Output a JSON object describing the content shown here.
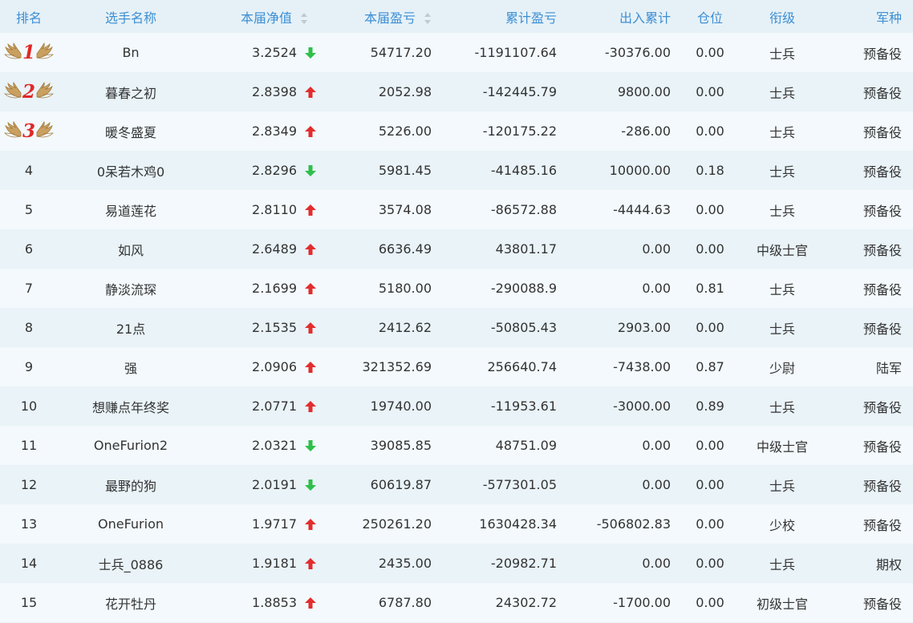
{
  "table": {
    "headers": {
      "rank": "排名",
      "player_name": "选手名称",
      "net_value": "本届净值",
      "profit": "本届盈亏",
      "cumulative_profit": "累计盈亏",
      "in_out_total": "出入累计",
      "position": "仓位",
      "rank_title": "衔级",
      "branch": "军种"
    },
    "sortable_columns": [
      "net_value",
      "profit"
    ],
    "rows": [
      {
        "rank": "1",
        "name": "Bn",
        "net_value": "3.2524",
        "trend": "down",
        "profit": "54717.20",
        "cumulative": "-1191107.64",
        "in_out": "-30376.00",
        "position": "0.00",
        "title": "士兵",
        "branch": "预备役"
      },
      {
        "rank": "2",
        "name": "暮春之初",
        "net_value": "2.8398",
        "trend": "up",
        "profit": "2052.98",
        "cumulative": "-142445.79",
        "in_out": "9800.00",
        "position": "0.00",
        "title": "士兵",
        "branch": "预备役"
      },
      {
        "rank": "3",
        "name": "暖冬盛夏",
        "net_value": "2.8349",
        "trend": "up",
        "profit": "5226.00",
        "cumulative": "-120175.22",
        "in_out": "-286.00",
        "position": "0.00",
        "title": "士兵",
        "branch": "预备役"
      },
      {
        "rank": "4",
        "name": "0呆若木鸡0",
        "net_value": "2.8296",
        "trend": "down",
        "profit": "5981.45",
        "cumulative": "-41485.16",
        "in_out": "10000.00",
        "position": "0.18",
        "title": "士兵",
        "branch": "预备役"
      },
      {
        "rank": "5",
        "name": "易道莲花",
        "net_value": "2.8110",
        "trend": "up",
        "profit": "3574.08",
        "cumulative": "-86572.88",
        "in_out": "-4444.63",
        "position": "0.00",
        "title": "士兵",
        "branch": "预备役"
      },
      {
        "rank": "6",
        "name": "如风",
        "net_value": "2.6489",
        "trend": "up",
        "profit": "6636.49",
        "cumulative": "43801.17",
        "in_out": "0.00",
        "position": "0.00",
        "title": "中级士官",
        "branch": "预备役"
      },
      {
        "rank": "7",
        "name": "静淡流琛",
        "net_value": "2.1699",
        "trend": "up",
        "profit": "5180.00",
        "cumulative": "-290088.9",
        "in_out": "0.00",
        "position": "0.81",
        "title": "士兵",
        "branch": "预备役"
      },
      {
        "rank": "8",
        "name": "21点",
        "net_value": "2.1535",
        "trend": "up",
        "profit": "2412.62",
        "cumulative": "-50805.43",
        "in_out": "2903.00",
        "position": "0.00",
        "title": "士兵",
        "branch": "预备役"
      },
      {
        "rank": "9",
        "name": "强",
        "net_value": "2.0906",
        "trend": "up",
        "profit": "321352.69",
        "cumulative": "256640.74",
        "in_out": "-7438.00",
        "position": "0.87",
        "title": "少尉",
        "branch": "陆军"
      },
      {
        "rank": "10",
        "name": "想赚点年终奖",
        "net_value": "2.0771",
        "trend": "up",
        "profit": "19740.00",
        "cumulative": "-11953.61",
        "in_out": "-3000.00",
        "position": "0.89",
        "title": "士兵",
        "branch": "预备役"
      },
      {
        "rank": "11",
        "name": "OneFurion2",
        "net_value": "2.0321",
        "trend": "down",
        "profit": "39085.85",
        "cumulative": "48751.09",
        "in_out": "0.00",
        "position": "0.00",
        "title": "中级士官",
        "branch": "预备役"
      },
      {
        "rank": "12",
        "name": "最野的狗",
        "net_value": "2.0191",
        "trend": "down",
        "profit": "60619.87",
        "cumulative": "-577301.05",
        "in_out": "0.00",
        "position": "0.00",
        "title": "士兵",
        "branch": "预备役"
      },
      {
        "rank": "13",
        "name": "OneFurion",
        "net_value": "1.9717",
        "trend": "up",
        "profit": "250261.20",
        "cumulative": "1630428.34",
        "in_out": "-506802.83",
        "position": "0.00",
        "title": "少校",
        "branch": "预备役"
      },
      {
        "rank": "14",
        "name": "士兵_0886",
        "net_value": "1.9181",
        "trend": "up",
        "profit": "2435.00",
        "cumulative": "-20982.71",
        "in_out": "0.00",
        "position": "0.00",
        "title": "士兵",
        "branch": "期权"
      },
      {
        "rank": "15",
        "name": "花开牡丹",
        "net_value": "1.8853",
        "trend": "up",
        "profit": "6787.80",
        "cumulative": "24302.72",
        "in_out": "-1700.00",
        "position": "0.00",
        "title": "初级士官",
        "branch": "预备役"
      }
    ]
  },
  "icons": {
    "trend_up": "up-arrow-icon",
    "trend_down": "down-arrow-icon",
    "medal": "laurel-wing-icon",
    "sort": "sort-icon"
  },
  "colors": {
    "header_text": "#3d8fd4",
    "trend_up": "#e22d2d",
    "trend_down": "#2fbf4a",
    "medal_number": "#e02828",
    "medal_wing": "#c9a060",
    "row_odd": "#f3f9fc",
    "row_even": "#e9f3f8"
  }
}
